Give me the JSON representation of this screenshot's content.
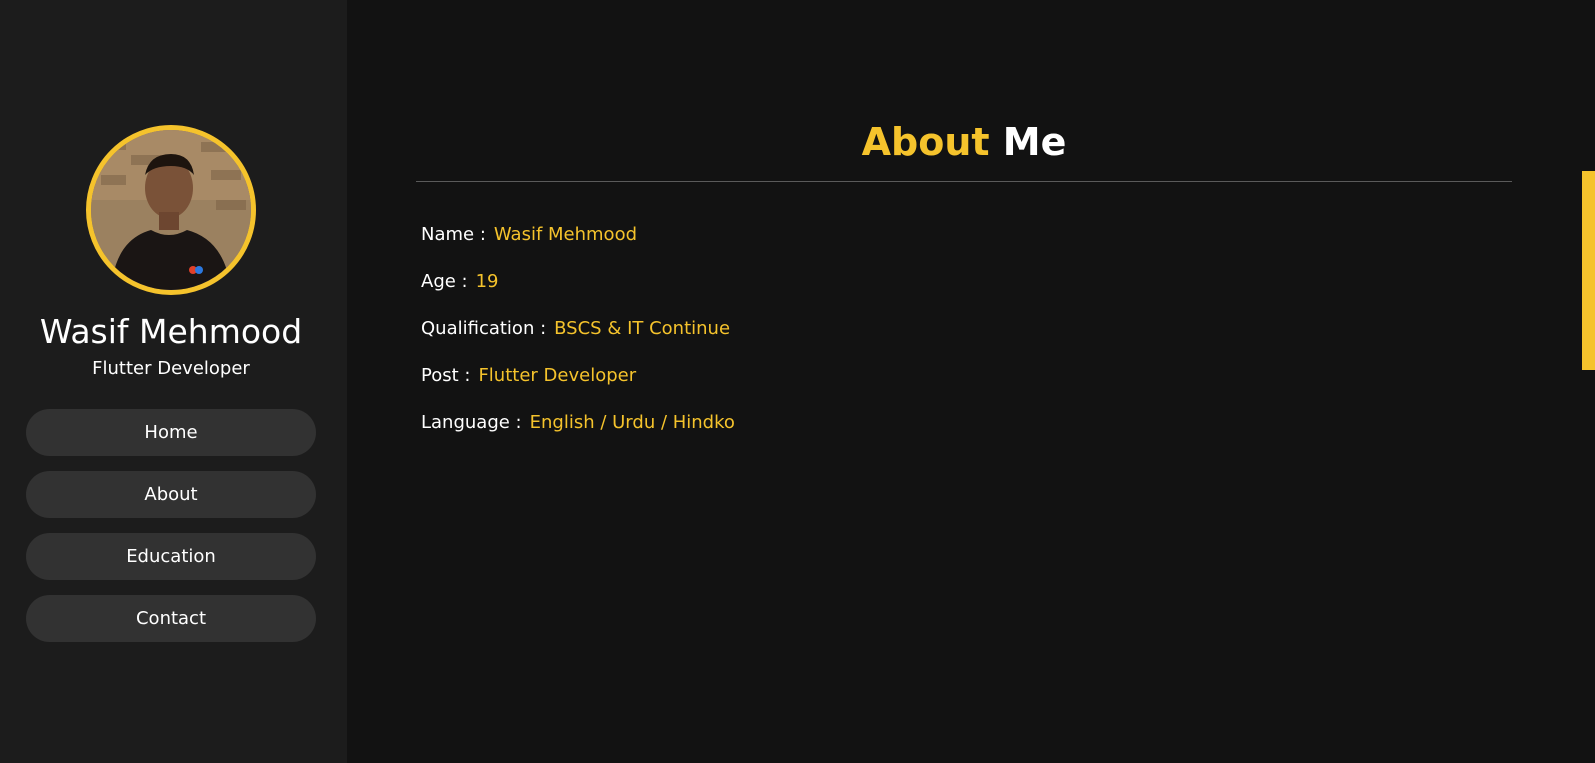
{
  "profile": {
    "name": "Wasif Mehmood",
    "role": "Flutter Developer"
  },
  "nav": {
    "items": [
      {
        "label": "Home"
      },
      {
        "label": "About"
      },
      {
        "label": "Education"
      },
      {
        "label": "Contact"
      }
    ]
  },
  "about": {
    "title_accent": "About",
    "title_rest": "Me",
    "rows": [
      {
        "label": "Name :",
        "value": "Wasif Mehmood"
      },
      {
        "label": "Age :",
        "value": "19"
      },
      {
        "label": "Qualification :",
        "value": "BSCS & IT Continue"
      },
      {
        "label": "Post :",
        "value": "Flutter Developer"
      },
      {
        "label": "Language :",
        "value": "English / Urdu / Hindko"
      }
    ]
  },
  "colors": {
    "accent": "#f5c32c",
    "background": "#121212",
    "sidebar": "#1c1c1c",
    "button": "#323232"
  }
}
